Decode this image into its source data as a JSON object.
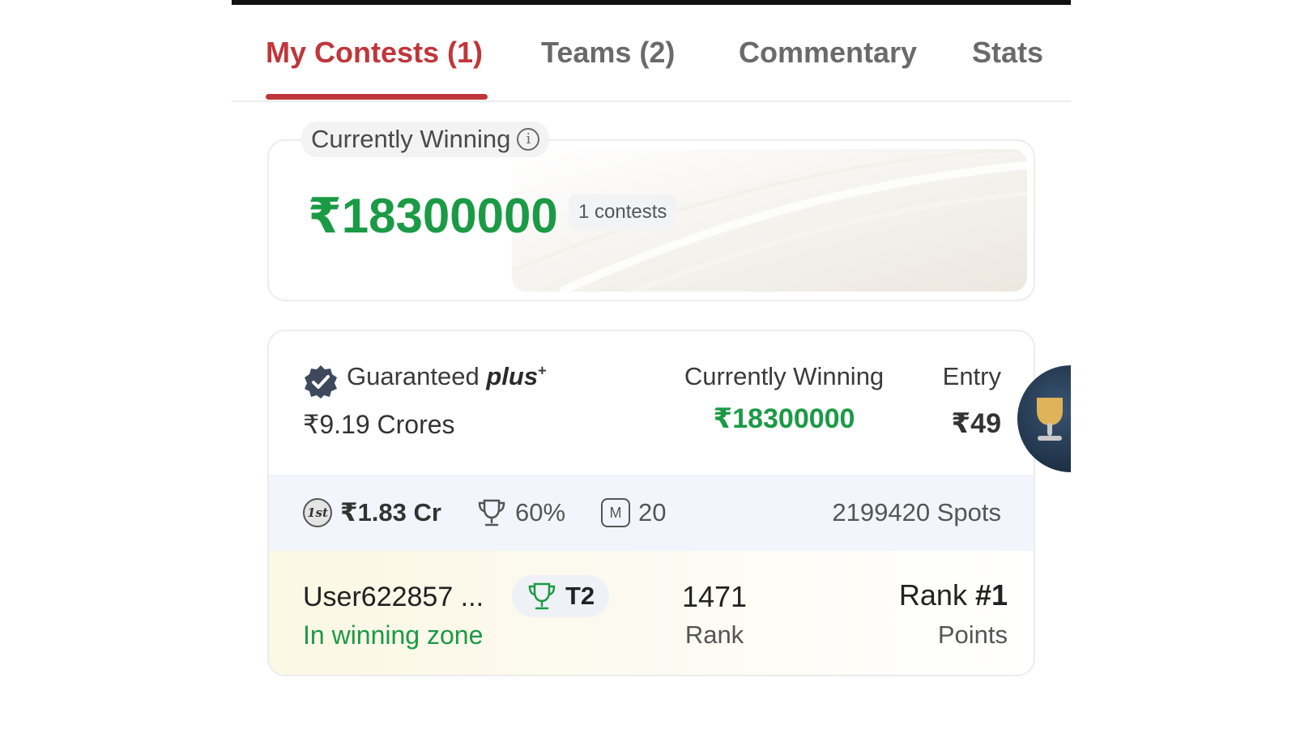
{
  "tabs": [
    {
      "label": "My Contests (1)",
      "active": true
    },
    {
      "label": "Teams (2)",
      "active": false
    },
    {
      "label": "Commentary",
      "active": false
    },
    {
      "label": "Stats",
      "active": false
    }
  ],
  "summary": {
    "label": "Currently Winning",
    "amount": "₹18300000",
    "contests_count": "1 contests"
  },
  "contest": {
    "type_label": "Guaranteed",
    "type_suffix": "plus",
    "type_sup": "+",
    "prize_pool": "₹9.19 Crores",
    "currently_winning_label": "Currently Winning",
    "currently_winning_value": "₹18300000",
    "entry_label": "Entry",
    "entry_value": "₹49",
    "first_prize": "₹1.83 Cr",
    "winners_percent": "60%",
    "max_teams": "20",
    "spots": "2199420 Spots",
    "team": {
      "username": "User622857 ...",
      "status": "In winning zone",
      "team_tag": "T2",
      "rank_value": "1471",
      "rank_label": "Rank",
      "points_prefix": "Rank ",
      "points_value": "#1",
      "points_label": "Points"
    }
  },
  "icons": {
    "first_prize_icon_text": "1st",
    "max_teams_icon_text": "M"
  },
  "colors": {
    "accent": "#c0363a",
    "winning_green": "#1b9a45",
    "tab_inactive": "#6a6a6a"
  }
}
